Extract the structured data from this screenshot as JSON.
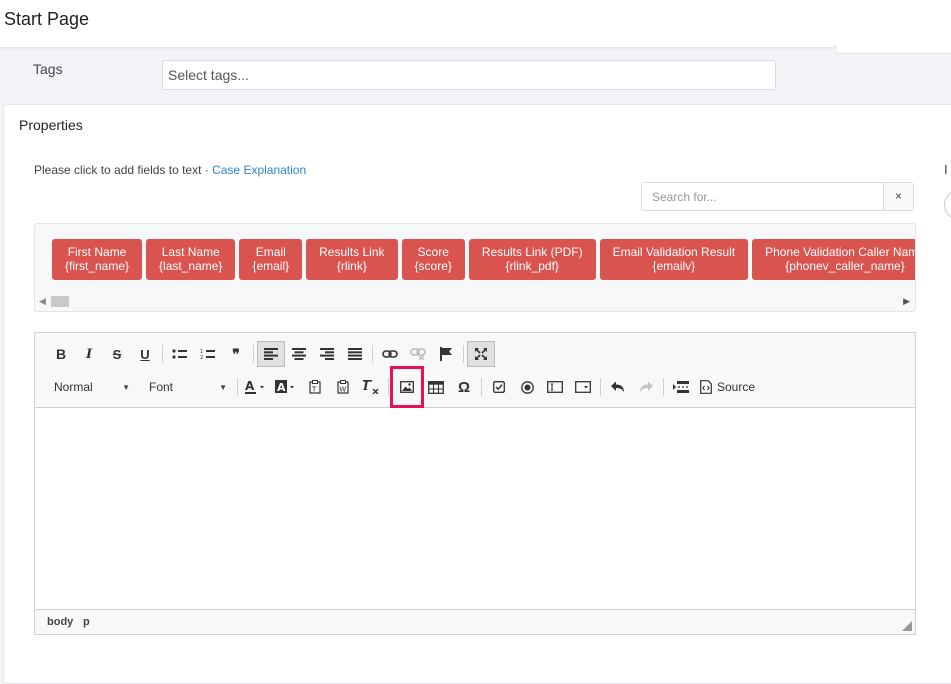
{
  "page": {
    "title": "Start Page"
  },
  "tags": {
    "label": "Tags",
    "placeholder": "Select tags..."
  },
  "properties": {
    "title": "Properties",
    "hint_text": "Please click to add fields to text · ",
    "hint_link": "Case Explanation",
    "right_partial": "I"
  },
  "search": {
    "placeholder": "Search for...",
    "clear_label": "×"
  },
  "fields": [
    {
      "name": "First Name",
      "tag": "{first_name}"
    },
    {
      "name": "Last Name",
      "tag": "{last_name}"
    },
    {
      "name": "Email",
      "tag": "{email}"
    },
    {
      "name": "Results Link",
      "tag": "{rlink}"
    },
    {
      "name": "Score",
      "tag": "{score}"
    },
    {
      "name": "Results Link (PDF)",
      "tag": "{rlink_pdf}"
    },
    {
      "name": "Email Validation Result",
      "tag": "{emailv}"
    },
    {
      "name": "Phone Validation Caller Name",
      "tag": "{phonev_caller_name}"
    },
    {
      "name": "",
      "tag": ""
    }
  ],
  "editor": {
    "format_combo": "Normal",
    "font_combo": "Font",
    "source_label": "Source",
    "status": {
      "body": "body",
      "p": "p"
    }
  },
  "colors": {
    "chip": "#d9534f",
    "highlight": "#e8105c",
    "link": "#2f87cc"
  }
}
